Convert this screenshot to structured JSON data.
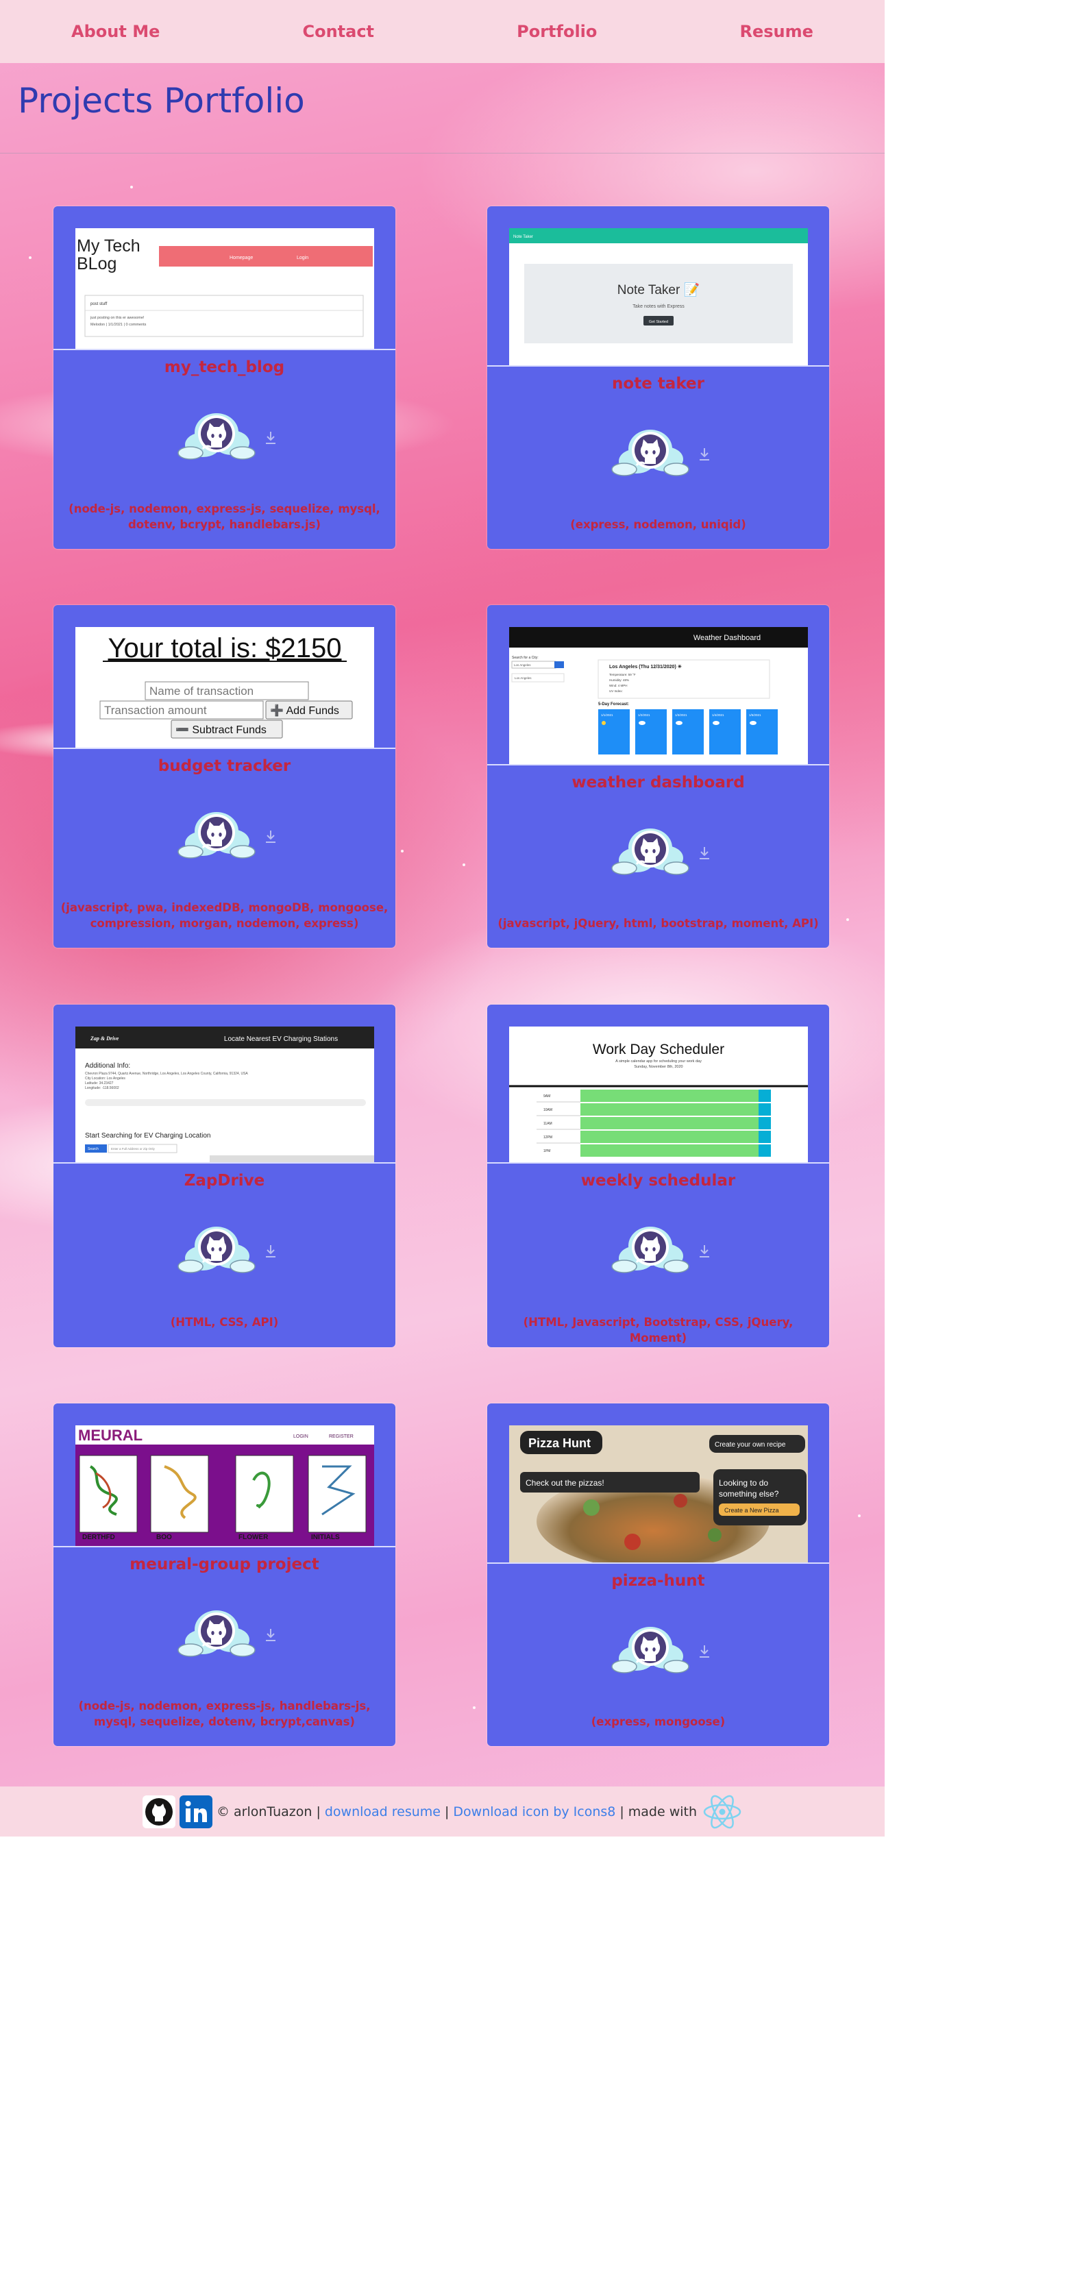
{
  "nav": {
    "about": "About Me",
    "contact": "Contact",
    "portfolio": "Portfolio",
    "resume": "Resume"
  },
  "page_title": "Projects Portfolio",
  "projects": [
    {
      "title": "my_tech_blog",
      "tech": "(node-js, nodemon, express-js, sequelize, mysql, dotenv, bcrypt, handlebars.js)"
    },
    {
      "title": "note taker",
      "tech": "(express, nodemon, uniqid)"
    },
    {
      "title": "budget tracker",
      "tech": "(javascript, pwa, indexedDB, mongoDB, mongoose, compression, morgan, nodemon, express)"
    },
    {
      "title": "weather dashboard",
      "tech": "(javascript, jQuery, html, bootstrap, moment, API)"
    },
    {
      "title": "ZapDrive",
      "tech": "(HTML, CSS, API)"
    },
    {
      "title": "weekly schedular",
      "tech": "(HTML, Javascript, Bootstrap, CSS, jQuery, Moment)"
    },
    {
      "title": "meural-group project",
      "tech": "(node-js, nodemon, express-js, handlebars-js, mysql, sequelize, dotenv, bcrypt,canvas)"
    },
    {
      "title": "pizza-hunt",
      "tech": "(express, mongoose)"
    }
  ],
  "screenshots": {
    "blog": {
      "heading": "My Tech BLog",
      "btn1": "Homepage",
      "btn2": "Login",
      "post_title": "post stuff",
      "post_body": "just posting on this er awesome!",
      "post_meta": "Melodon | 1/1/2021 | 0 comments"
    },
    "note": {
      "nav": "Note Taker",
      "heading": "Note Taker 📝",
      "sub": "Take notes with Express",
      "btn": "Get Started"
    },
    "budget": {
      "total": "Your total is: $2150",
      "ph_name": "Name of transaction",
      "ph_amount": "Transaction amount",
      "add": "➕ Add Funds",
      "sub": "➖ Subtract Funds"
    },
    "weather": {
      "header": "Weather Dashboard",
      "search_label": "Search for a City:",
      "search_value": "Los Angeles",
      "city_list": "Los Angeles",
      "city_line": "Los Angeles (Thu 12/31/2020) ☀",
      "temp": "Temperature: 59 °F",
      "humidity": "Humidity: 48%",
      "wind": "Wind: 4 MPH",
      "uv": "UV Index:",
      "forecast_label": "5-Day Forecast:",
      "forecast": [
        "1/1/2021",
        "1/2/2021",
        "1/3/2021",
        "1/4/2021",
        "1/5/2021"
      ]
    },
    "zap": {
      "brand": "Zap & Drive",
      "header": "Locate Nearest EV Charging Stations",
      "info_title": "Additional Info:",
      "info1": "Chevron Plaza 9744, Quartz Avenue, Northridge, Los Angeles, Los Angeles County, California, 91324, USA",
      "info2": "City Location: Los Angeles",
      "info3": "Latitude: 34.23427",
      "info4": "Longitude: -118.56002",
      "search_title": "Start Searching for EV Charging Location",
      "search_btn": "Search",
      "search_hint": "Enter a Full Address or Zip Only"
    },
    "scheduler": {
      "title": "Work Day Scheduler",
      "sub1": "A simple calendar app for scheduling your work day",
      "sub2": "Sunday, November 8th, 2020",
      "hours": [
        "9AM",
        "10AM",
        "11AM",
        "12PM",
        "1PM"
      ]
    },
    "meural": {
      "logo": "MEURAL",
      "login": "LOGIN",
      "register": "REGISTER",
      "tiles": [
        "DERTHFD",
        "BOO",
        "FLOWER",
        "INITIALS"
      ],
      "tile_sub": "by tha"
    },
    "pizza": {
      "logo": "Pizza Hunt",
      "bubble1": "Create your own recipe",
      "bubble2": "Check out the pizzas!",
      "bubble3": "Looking to do something else?",
      "btn": "Create a New Pizza"
    }
  },
  "footer": {
    "copyright": "© arlonTuazon",
    "sep": "|",
    "resume_link": "download resume",
    "icons_link": "Download icon by Icons8",
    "made_with": "made with"
  }
}
